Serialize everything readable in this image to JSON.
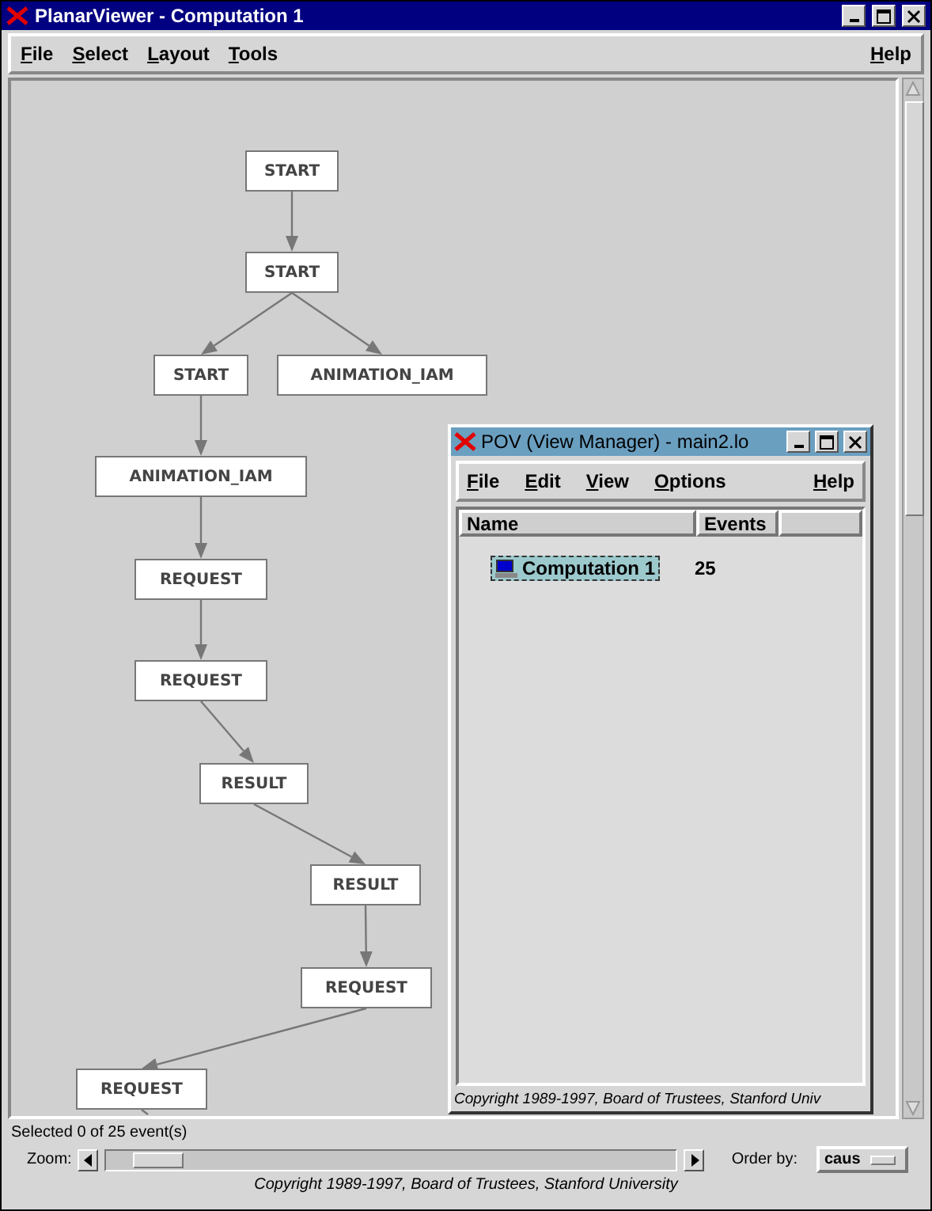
{
  "window": {
    "title": "PlanarViewer - Computation 1"
  },
  "menu": [
    {
      "mnemonic": "F",
      "rest": "ile"
    },
    {
      "mnemonic": "S",
      "rest": "elect"
    },
    {
      "mnemonic": "L",
      "rest": "ayout"
    },
    {
      "mnemonic": "T",
      "rest": "ools"
    }
  ],
  "help_menu": {
    "mnemonic": "H",
    "rest": "elp"
  },
  "graph": {
    "nodes": [
      {
        "label": "START"
      },
      {
        "label": "START"
      },
      {
        "label": "START"
      },
      {
        "label": "ANIMATION_IAM"
      },
      {
        "label": "ANIMATION_IAM"
      },
      {
        "label": "REQUEST"
      },
      {
        "label": "REQUEST"
      },
      {
        "label": "RESULT"
      },
      {
        "label": "RESULT"
      },
      {
        "label": "REQUEST"
      },
      {
        "label": "REQUEST"
      }
    ]
  },
  "status": "Selected 0 of 25 event(s)",
  "zoom": {
    "label": "Zoom:",
    "level": 0.05
  },
  "order_by": {
    "label": "Order by:",
    "value": "caus"
  },
  "copyright": "Copyright 1989-1997, Board of Trustees, Stanford University",
  "pov": {
    "title": "POV (View Manager) - main2.lo",
    "menu": [
      {
        "mnemonic": "F",
        "rest": "ile"
      },
      {
        "mnemonic": "E",
        "rest": "dit"
      },
      {
        "mnemonic": "V",
        "rest": "iew"
      },
      {
        "mnemonic": "O",
        "rest": "ptions"
      }
    ],
    "help_menu": {
      "mnemonic": "H",
      "rest": "elp"
    },
    "columns": [
      "Name",
      "Events"
    ],
    "rows": [
      {
        "name": "Computation 1",
        "events": "25",
        "selected": true
      }
    ],
    "copyright": "Copyright 1989-1997, Board of Trustees, Stanford Univ"
  }
}
